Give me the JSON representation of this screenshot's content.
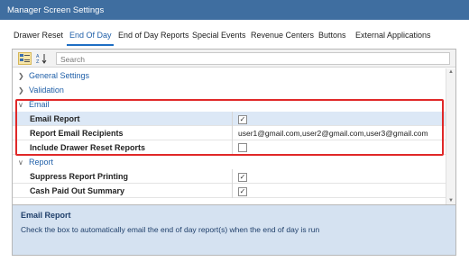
{
  "window": {
    "title": "Manager Screen Settings"
  },
  "tabs": [
    {
      "label": "Drawer Reset"
    },
    {
      "label": "End Of Day"
    },
    {
      "label": "End of Day Reports"
    },
    {
      "label": "Special Events"
    },
    {
      "label": "Revenue Centers"
    },
    {
      "label": "Buttons"
    },
    {
      "label": "External Applications"
    }
  ],
  "active_tab": "End Of Day",
  "toolbar": {
    "search_placeholder": "Search"
  },
  "categories": {
    "general": "General Settings",
    "validation": "Validation",
    "email": "Email",
    "report": "Report"
  },
  "email_props": {
    "email_report": {
      "label": "Email Report",
      "checked": true
    },
    "recipients": {
      "label": "Report Email Recipients",
      "value": "user1@gmail.com,user2@gmail.com,user3@gmail.com"
    },
    "include_drawer": {
      "label": "Include Drawer Reset Reports",
      "checked": false
    }
  },
  "report_props": {
    "suppress": {
      "label": "Suppress Report Printing",
      "checked": true
    },
    "cash_paid": {
      "label": "Cash Paid Out Summary",
      "checked": true
    }
  },
  "description": {
    "title": "Email Report",
    "text": "Check the box to automatically email the end of day report(s) when the end of day is run"
  },
  "colors": {
    "titlebar": "#3f6ea0",
    "accent": "#1f6fc4",
    "highlight_border": "#e02828",
    "description_bg": "#d5e2f1"
  }
}
